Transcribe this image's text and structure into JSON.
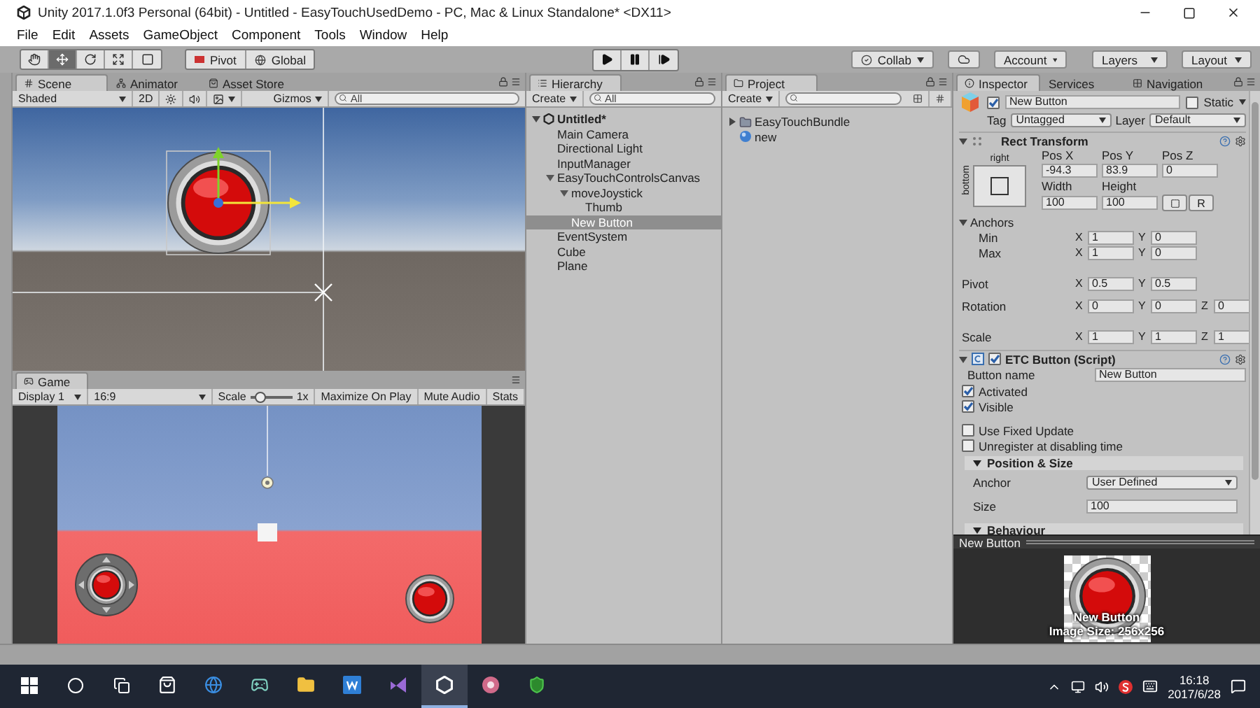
{
  "window": {
    "title": "Unity 2017.1.0f3 Personal (64bit) - Untitled - EasyTouchUsedDemo - PC, Mac & Linux Standalone* <DX11>"
  },
  "menu": [
    "File",
    "Edit",
    "Assets",
    "GameObject",
    "Component",
    "Tools",
    "Window",
    "Help"
  ],
  "toolbar": {
    "tools": [
      {
        "kind": "hand",
        "selected": false
      },
      {
        "kind": "move",
        "selected": true
      },
      {
        "kind": "rotate",
        "selected": false
      },
      {
        "kind": "scale",
        "selected": false
      },
      {
        "kind": "rect",
        "selected": false
      }
    ],
    "pivot": "Pivot",
    "space": "Global",
    "collab": "Collab",
    "account": "Account",
    "layers": "Layers",
    "layout": "Layout"
  },
  "scene": {
    "tabs": [
      {
        "label": "Scene",
        "selected": true
      },
      {
        "label": "Animator",
        "selected": false
      },
      {
        "label": "Asset Store",
        "selected": false
      }
    ],
    "shading": "Shaded",
    "mode": "2D",
    "lighting_on": false,
    "audio_on": false,
    "gizmos": "Gizmos",
    "search": {
      "placeholder": "All"
    }
  },
  "game": {
    "tab": "Game",
    "display": "Display 1",
    "aspect": "16:9",
    "scale_label": "Scale",
    "scale": {
      "level": 0.12
    },
    "scale_value": "1x",
    "options": [
      {
        "label": "Maximize On Play",
        "on": false
      },
      {
        "label": "Mute Audio",
        "on": false
      },
      {
        "label": "Stats",
        "on": false
      }
    ]
  },
  "hierarchy": {
    "tab": "Hierarchy",
    "create": "Create",
    "search": {
      "placeholder": "All"
    },
    "scene": {
      "label": "Untitled*",
      "expanded": true
    },
    "items": [
      {
        "label": "Main Camera",
        "selected": false
      },
      {
        "label": "Directional Light",
        "selected": false
      },
      {
        "label": "InputManager",
        "selected": false
      },
      {
        "label": "EasyTouchControlsCanvas",
        "selected": false,
        "expanded": true,
        "children": [
          {
            "label": "moveJoystick",
            "selected": false,
            "expanded": true,
            "children": [
              {
                "label": "Thumb",
                "selected": false
              }
            ]
          },
          {
            "label": "New Button",
            "selected": true
          }
        ]
      },
      {
        "label": "EventSystem",
        "selected": false
      },
      {
        "label": "Cube",
        "selected": false
      },
      {
        "label": "Plane",
        "selected": false
      }
    ]
  },
  "project": {
    "tab": "Project",
    "create": "Create",
    "items": [
      {
        "kind": "folder",
        "label": "EasyTouchBundle",
        "expanded": false
      },
      {
        "kind": "scene",
        "label": "new"
      }
    ]
  },
  "inspector": {
    "tabs": [
      {
        "label": "Inspector",
        "selected": true
      },
      {
        "label": "Services",
        "selected": false
      },
      {
        "label": "Navigation",
        "selected": false
      }
    ],
    "object": {
      "active": true,
      "name": "New Button",
      "static": false,
      "static_label": "Static",
      "tag_label": "Tag",
      "tag": "Untagged",
      "layer_label": "Layer",
      "layer": "Default"
    },
    "rect_transform": {
      "title": "Rect Transform",
      "expanded": true,
      "preset_top": "right",
      "preset_side": "bottom",
      "fields": [
        {
          "label": "Pos X",
          "value": "-94.3"
        },
        {
          "label": "Pos Y",
          "value": "83.9"
        },
        {
          "label": "Pos Z",
          "value": "0"
        },
        {
          "label": "Width",
          "value": "100"
        },
        {
          "label": "Height",
          "value": "100"
        }
      ],
      "raw_button": "R",
      "rows": [
        {
          "label": "Anchors",
          "expanded": true,
          "children": [
            {
              "label": "Min",
              "values": [
                {
                  "axis": "X",
                  "value": "1"
                },
                {
                  "axis": "Y",
                  "value": "0"
                }
              ]
            },
            {
              "label": "Max",
              "values": [
                {
                  "axis": "X",
                  "value": "1"
                },
                {
                  "axis": "Y",
                  "value": "0"
                }
              ]
            }
          ]
        },
        {
          "label": "Pivot",
          "values": [
            {
              "axis": "X",
              "value": "0.5"
            },
            {
              "axis": "Y",
              "value": "0.5"
            }
          ]
        },
        {
          "label": "Rotation",
          "values": [
            {
              "axis": "X",
              "value": "0"
            },
            {
              "axis": "Y",
              "value": "0"
            },
            {
              "axis": "Z",
              "value": "0"
            }
          ]
        },
        {
          "label": "Scale",
          "values": [
            {
              "axis": "X",
              "value": "1"
            },
            {
              "axis": "Y",
              "value": "1"
            },
            {
              "axis": "Z",
              "value": "1"
            }
          ]
        }
      ]
    },
    "etc_button": {
      "title": "ETC Button (Script)",
      "expanded": true,
      "enabled": true,
      "name_label": "Button name",
      "name_value": "New Button",
      "toggles": [
        {
          "label": "Activated",
          "checked": true
        },
        {
          "label": "Visible",
          "checked": true
        },
        {
          "label": "Use Fixed Update",
          "checked": false
        },
        {
          "label": "Unregister at disabling time",
          "checked": false
        }
      ],
      "sections": [
        {
          "title": "Position & Size",
          "expanded": true,
          "fields": [
            {
              "kind": "dropdown",
              "label": "Anchor",
              "value": "User Defined"
            },
            {
              "kind": "text",
              "label": "Size",
              "value": "100"
            }
          ]
        },
        {
          "title": "Behaviour",
          "expanded": true
        }
      ]
    }
  },
  "preview": {
    "title": "New Button",
    "caption": "New Button",
    "image_size": "Image Size: 256x256"
  },
  "taskbar": {
    "time": "16:18",
    "date": "2017/6/28"
  }
}
